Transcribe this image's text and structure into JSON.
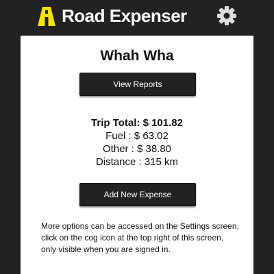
{
  "header": {
    "app_title": "Road Expenser",
    "logo_icon": "road-logo-icon",
    "settings_icon": "gear-icon",
    "logo_color": "#f2e600"
  },
  "trip": {
    "name": "Whah Wha",
    "view_reports_label": "View Reports",
    "add_expense_label": "Add New Expense"
  },
  "summary": {
    "total": "Trip Total: $ 101.82",
    "fuel": "Fuel : $ 63.02",
    "other": "Other : $ 38.80",
    "distance": "Distance : 315 km"
  },
  "note": "More options can be accessed on the Settings screen, click on the cog icon at the top right of this screen, only visible when you are signed in."
}
